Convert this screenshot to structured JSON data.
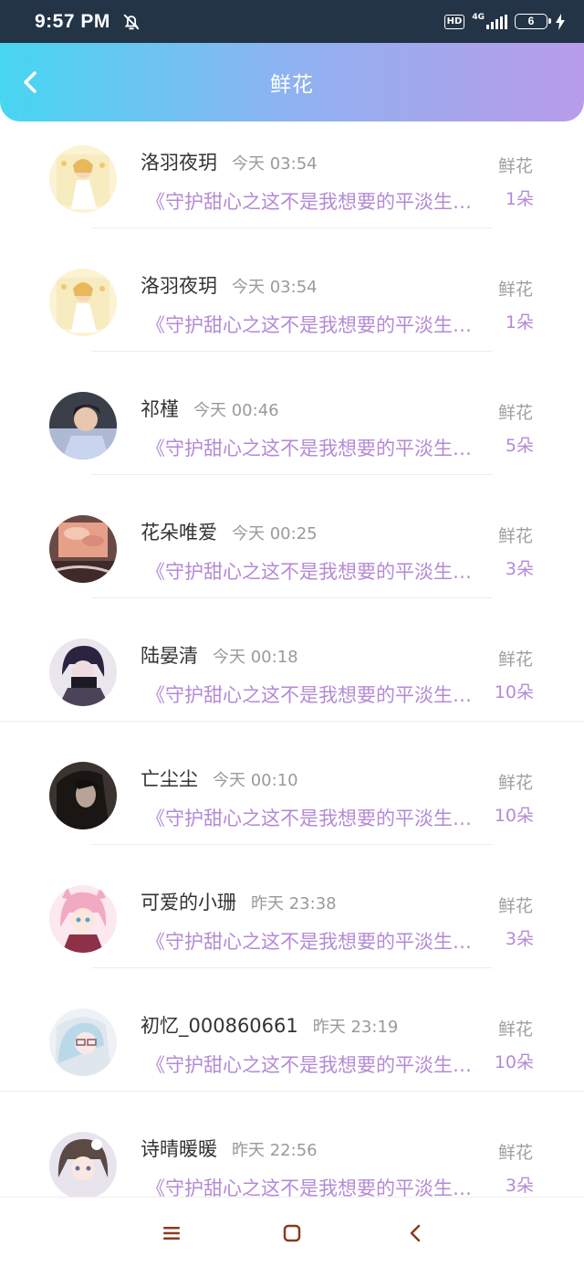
{
  "status_bar": {
    "time": "9:57 PM",
    "hd": "HD",
    "network": "4G",
    "battery": "6"
  },
  "header": {
    "title": "鲜花",
    "back_icon": "chevron-left-icon"
  },
  "records": [
    {
      "name": "洛羽夜玥",
      "time": "今天 03:54",
      "title": "《守护甜心之这不是我想要的平淡生活》",
      "type": "鲜花",
      "count": "1朵",
      "avatar": "anime-girl-yellow"
    },
    {
      "name": "洛羽夜玥",
      "time": "今天 03:54",
      "title": "《守护甜心之这不是我想要的平淡生活》",
      "type": "鲜花",
      "count": "1朵",
      "avatar": "anime-girl-yellow"
    },
    {
      "name": "祁槿",
      "time": "今天 00:46",
      "title": "《守护甜心之这不是我想要的平淡生活》",
      "type": "鲜花",
      "count": "5朵",
      "avatar": "boy-blue"
    },
    {
      "name": "花朵唯爱",
      "time": "今天 00:25",
      "title": "《守护甜心之这不是我想要的平淡生活》",
      "type": "鲜花",
      "count": "3朵",
      "avatar": "sunset-room"
    },
    {
      "name": "陆晏清",
      "time": "今天 00:18",
      "title": "《守护甜心之这不是我想要的平淡生活》",
      "type": "鲜花",
      "count": "10朵",
      "avatar": "anime-boy-dark"
    },
    {
      "name": "亡尘尘",
      "time": "今天 00:10",
      "title": "《守护甜心之这不是我想要的平淡生活》",
      "type": "鲜花",
      "count": "10朵",
      "avatar": "dark-portrait"
    },
    {
      "name": "可爱的小珊",
      "time": "昨天 23:38",
      "title": "《守护甜心之这不是我想要的平淡生活》",
      "type": "鲜花",
      "count": "3朵",
      "avatar": "anime-girl-pink"
    },
    {
      "name": "初忆_000860661",
      "time": "昨天 23:19",
      "title": "《守护甜心之这不是我想要的平淡生活》",
      "type": "鲜花",
      "count": "10朵",
      "avatar": "anime-girl-glasses"
    },
    {
      "name": "诗晴暖暖",
      "time": "昨天 22:56",
      "title": "《守护甜心之这不是我想要的平淡生活》",
      "type": "鲜花",
      "count": "3朵",
      "avatar": "anime-girl-brown"
    }
  ],
  "nav": {
    "menu_icon": "menu-icon",
    "home_icon": "home-square-icon",
    "back_icon": "back-triangle-icon"
  },
  "colors": {
    "accent_purple": "#b48ad6",
    "header_gradient_start": "#47d6f1",
    "header_gradient_end": "#b99ce9"
  }
}
